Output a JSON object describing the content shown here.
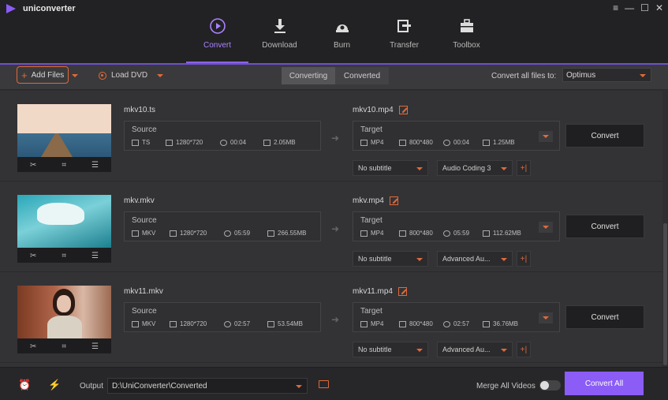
{
  "app": {
    "title": "uniconverter",
    "window_controls": [
      "≡",
      "—",
      "☐",
      "✕"
    ]
  },
  "nav": [
    {
      "label": "Convert",
      "icon": "convert-icon",
      "active": true
    },
    {
      "label": "Download",
      "icon": "download-icon",
      "active": false
    },
    {
      "label": "Burn",
      "icon": "burn-icon",
      "active": false
    },
    {
      "label": "Transfer",
      "icon": "transfer-icon",
      "active": false
    },
    {
      "label": "Toolbox",
      "icon": "toolbox-icon",
      "active": false
    }
  ],
  "toolbar": {
    "add_files": "Add Files",
    "load_dvd": "Load DVD",
    "tabs": [
      "Converting",
      "Converted"
    ],
    "convert_all_to_label": "Convert all files to:",
    "format": "Optimus"
  },
  "files": [
    {
      "source_name": "mkv10.ts",
      "source_label": "Source",
      "src_format": "TS",
      "src_res": "1280*720",
      "src_dur": "00:04",
      "src_size": "2.05MB",
      "target_name": "mkv10.mp4",
      "target_label": "Target",
      "tgt_format": "MP4",
      "tgt_res": "800*480",
      "tgt_dur": "00:04",
      "tgt_size": "1.25MB",
      "subtitle": "No subtitle",
      "audio": "Audio Coding 3",
      "convert": "Convert"
    },
    {
      "source_name": "mkv.mkv",
      "source_label": "Source",
      "src_format": "MKV",
      "src_res": "1280*720",
      "src_dur": "05:59",
      "src_size": "266.55MB",
      "target_name": "mkv.mp4",
      "target_label": "Target",
      "tgt_format": "MP4",
      "tgt_res": "800*480",
      "tgt_dur": "05:59",
      "tgt_size": "112.62MB",
      "subtitle": "No subtitle",
      "audio": "Advanced Au...",
      "convert": "Convert"
    },
    {
      "source_name": "mkv11.mkv",
      "source_label": "Source",
      "src_format": "MKV",
      "src_res": "1280*720",
      "src_dur": "02:57",
      "src_size": "53.54MB",
      "target_name": "mkv11.mp4",
      "target_label": "Target",
      "tgt_format": "MP4",
      "tgt_res": "800*480",
      "tgt_dur": "02:57",
      "tgt_size": "36.76MB",
      "subtitle": "No subtitle",
      "audio": "Advanced Au...",
      "convert": "Convert"
    }
  ],
  "bottom": {
    "output_label": "Output",
    "output_path": "D:\\UniConverter\\Converted",
    "merge_label": "Merge All Videos",
    "convert_all": "Convert All"
  },
  "colors": {
    "accent": "#8b5cf6",
    "highlight": "#e06a3a"
  }
}
